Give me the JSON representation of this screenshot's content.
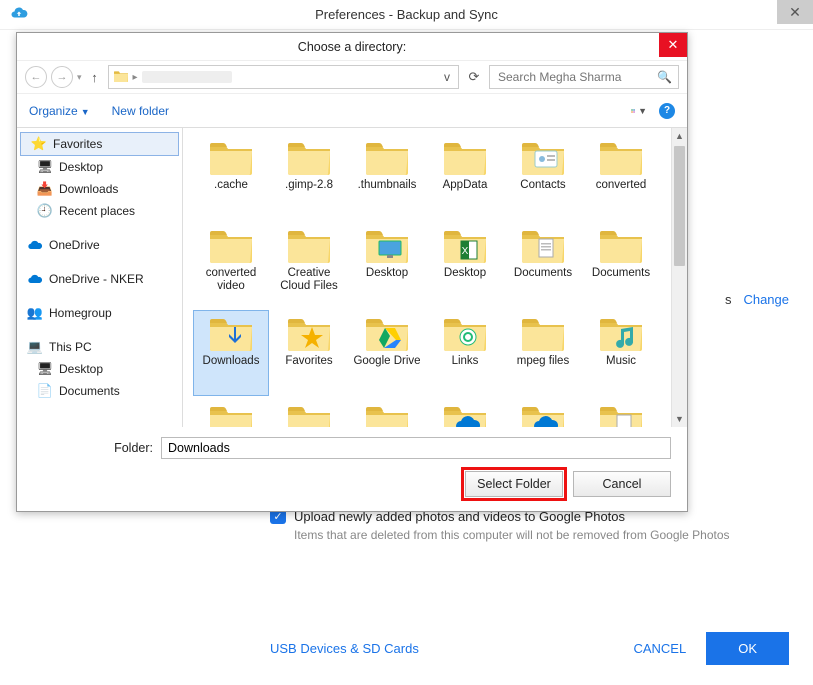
{
  "outer": {
    "title": "Preferences - Backup and Sync",
    "close_symbol": "✕"
  },
  "right_peek": {
    "s_label": "s",
    "change": "Change"
  },
  "bottom": {
    "chk_label": "Upload newly added photos and videos to Google Photos",
    "subnote": "Items that are deleted from this computer will not be removed from Google Photos",
    "usb_link": "USB Devices & SD Cards",
    "cancel": "CANCEL",
    "ok": "OK"
  },
  "dialog": {
    "title": "Choose a directory:",
    "close_symbol": "✕",
    "nav": {
      "back": "←",
      "fwd": "→",
      "up": "↑",
      "chev": "v",
      "refresh": "⟳"
    },
    "search_placeholder": "Search Megha Sharma",
    "toolbar": {
      "organize": "Organize",
      "new_folder": "New folder"
    },
    "tree": {
      "favorites": "Favorites",
      "fav_items": [
        "Desktop",
        "Downloads",
        "Recent places"
      ],
      "onedrive": "OneDrive",
      "onedrive_nker": "OneDrive - NKER",
      "homegroup": "Homegroup",
      "thispc": "This PC",
      "pc_items": [
        "Desktop",
        "Documents"
      ]
    },
    "folders": [
      {
        "label": ".cache",
        "overlay": null
      },
      {
        "label": ".gimp-2.8",
        "overlay": null
      },
      {
        "label": ".thumbnails",
        "overlay": null
      },
      {
        "label": "AppData",
        "overlay": null
      },
      {
        "label": "Contacts",
        "overlay": "contacts"
      },
      {
        "label": "converted",
        "overlay": null
      },
      {
        "label": "converted video",
        "overlay": null
      },
      {
        "label": "Creative Cloud Files",
        "overlay": null
      },
      {
        "label": "Desktop",
        "overlay": "desktop"
      },
      {
        "label": "Desktop",
        "overlay": "excel"
      },
      {
        "label": "Documents",
        "overlay": "docs"
      },
      {
        "label": "Documents",
        "overlay": null
      },
      {
        "label": "Downloads",
        "overlay": "download",
        "selected": true
      },
      {
        "label": "Favorites",
        "overlay": "star"
      },
      {
        "label": "Google Drive",
        "overlay": "gdrive"
      },
      {
        "label": "Links",
        "overlay": "link"
      },
      {
        "label": "mpeg files",
        "overlay": null
      },
      {
        "label": "Music",
        "overlay": "music"
      },
      {
        "label": "",
        "overlay": null
      },
      {
        "label": "",
        "overlay": null
      },
      {
        "label": "",
        "overlay": null
      },
      {
        "label": "",
        "overlay": "cloud"
      },
      {
        "label": "",
        "overlay": "cloud"
      },
      {
        "label": "",
        "overlay": "page"
      }
    ],
    "folder_label": "Folder:",
    "folder_value": "Downloads",
    "select": "Select Folder",
    "cancel": "Cancel"
  }
}
